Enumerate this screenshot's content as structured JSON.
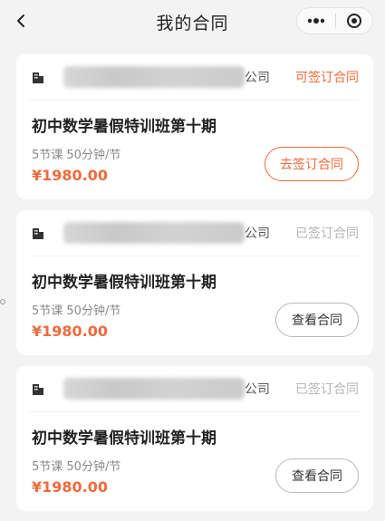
{
  "nav": {
    "title": "我的合同",
    "back_icon": "chevron-left-icon",
    "more_icon": "more-dots-icon",
    "target_icon": "target-icon"
  },
  "colors": {
    "accent": "#f06a3c",
    "muted": "#b5b5b5",
    "background": "#f3f3f3"
  },
  "contracts": [
    {
      "company_suffix": "公司",
      "status": "可签订合同",
      "status_kind": "open",
      "course_title": "初中数学暑假特训班第十期",
      "meta": "5节课  50分钟/节",
      "price": "¥1980.00",
      "action_label": "去签订合同"
    },
    {
      "company_suffix": "公司",
      "status": "已签订合同",
      "status_kind": "done",
      "course_title": "初中数学暑假特训班第十期",
      "meta": "5节课  50分钟/节",
      "price": "¥1980.00",
      "action_label": "查看合同"
    },
    {
      "company_suffix": "公司",
      "status": "已签订合同",
      "status_kind": "done",
      "course_title": "初中数学暑假特训班第十期",
      "meta": "5节课  50分钟/节",
      "price": "¥1980.00",
      "action_label": "查看合同"
    }
  ]
}
